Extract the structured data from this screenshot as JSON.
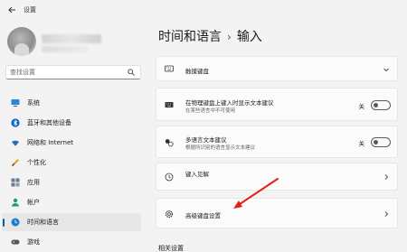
{
  "window": {
    "app_title": "设置"
  },
  "sidebar": {
    "search_placeholder": "查找设置",
    "items": [
      {
        "label": "系统",
        "icon": "monitor-icon"
      },
      {
        "label": "蓝牙和其他设备",
        "icon": "bluetooth-icon"
      },
      {
        "label": "网络和 Internet",
        "icon": "wifi-icon"
      },
      {
        "label": "个性化",
        "icon": "brush-icon"
      },
      {
        "label": "应用",
        "icon": "apps-icon"
      },
      {
        "label": "帐户",
        "icon": "person-icon"
      },
      {
        "label": "时间和语言",
        "icon": "globe-clock-icon",
        "active": true
      },
      {
        "label": "游戏",
        "icon": "gamepad-icon"
      }
    ]
  },
  "main": {
    "breadcrumb_parent": "时间和语言",
    "breadcrumb_separator": "›",
    "breadcrumb_current": "输入",
    "cards": [
      {
        "title": "触摸键盘",
        "icon": "keyboard-icon",
        "control": "expand"
      },
      {
        "title": "在物理键盘上键入时显示文本建议",
        "subtitle": "在某些语言中不可使用",
        "icon": "keyboard-icon",
        "control": "toggle",
        "toggle_label": "关",
        "toggle_on": false
      },
      {
        "title": "多语言文本建议",
        "subtitle": "根据所识别的语言显示文本建议",
        "icon": "multilingual-icon",
        "control": "toggle",
        "toggle_label": "关",
        "toggle_on": false
      },
      {
        "title": "键入见解",
        "icon": "history-icon",
        "control": "chevron"
      },
      {
        "title": "高级键盘设置",
        "icon": "gear-icon",
        "control": "chevron"
      }
    ],
    "related_label": "相关设置"
  },
  "colors": {
    "accent": "#005fb8",
    "annotation_arrow": "#e02020",
    "background": "#f3f3f3",
    "card": "#fbfbfb"
  }
}
